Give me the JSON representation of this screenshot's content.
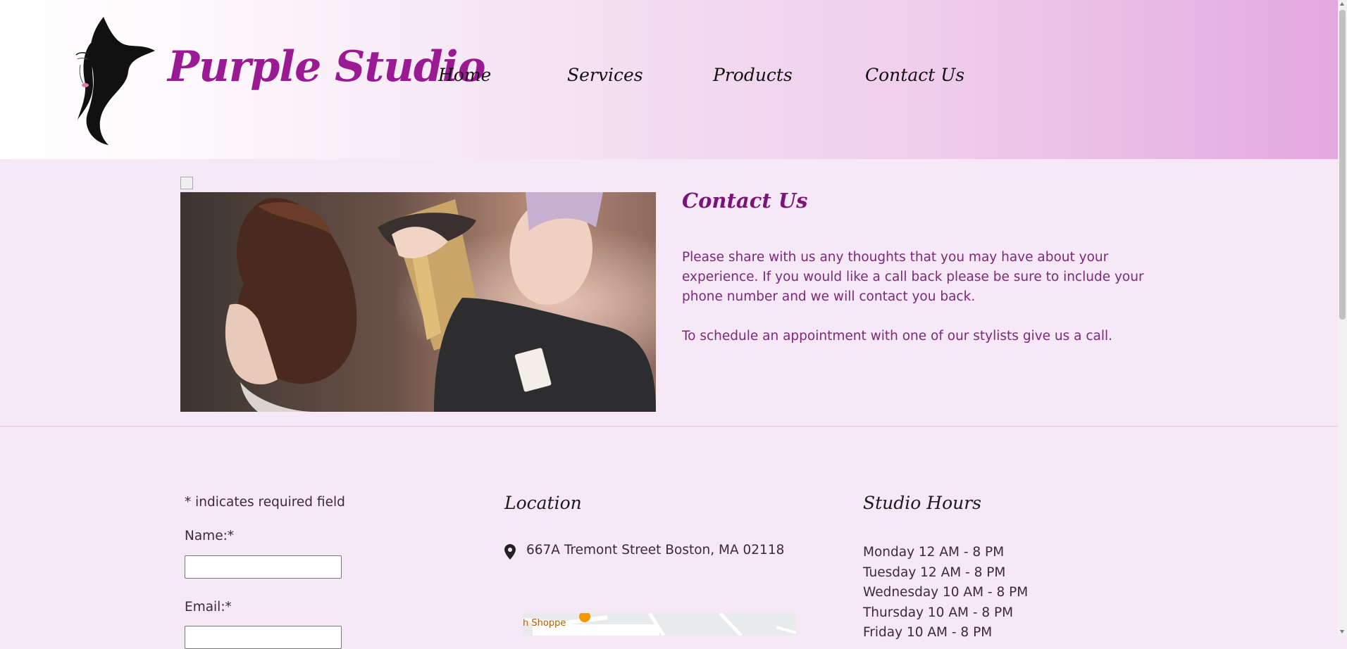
{
  "header": {
    "brand": "Purple Studio",
    "nav": [
      {
        "label": "Home"
      },
      {
        "label": "Services"
      },
      {
        "label": "Products"
      },
      {
        "label": "Contact Us"
      }
    ]
  },
  "contact": {
    "title": "Contact Us",
    "paragraph1": "Please share with us any thoughts that you may have about your experience. If you would like a call back please be sure to include your phone number and we will contact you back.",
    "paragraph2": "To schedule an appointment with one of our stylists give us a call."
  },
  "form": {
    "required_note": "* indicates required field",
    "name_label": "Name:*",
    "email_label": "Email:*"
  },
  "location": {
    "title": "Location",
    "address": "667A Tremont Street Boston, MA 02118",
    "map_snippet": "h Shoppe"
  },
  "hours": {
    "title": "Studio Hours",
    "days": [
      "Monday 12 AM - 8 PM",
      "Tuesday 12 AM - 8 PM",
      "Wednesday 10 AM - 8 PM",
      "Thursday 10 AM - 8 PM",
      "Friday 10 AM - 8 PM"
    ]
  },
  "colors": {
    "brand": "#9a1a94",
    "accent_text": "#7a2a78",
    "page_bg": "#f6e8f6"
  }
}
